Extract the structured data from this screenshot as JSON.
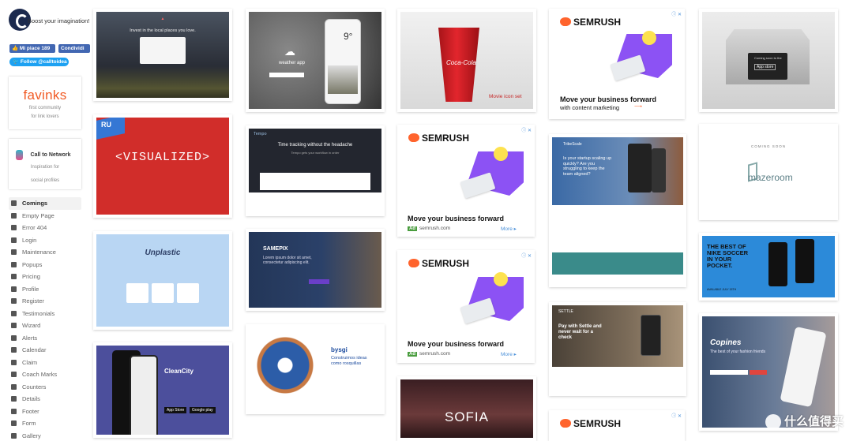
{
  "sidebar": {
    "tagline": "Boost your imagination!",
    "fb_like": "Mi piace 189",
    "fb_share": "Condividi",
    "twitter_follow": "Follow @calltoidea",
    "favinks": {
      "name": "favinks",
      "sub1": "first community",
      "sub2": "for link lovers"
    },
    "ctn": {
      "name": "Call to Network",
      "sub1": "Inspiration for",
      "sub2": "social profiles"
    },
    "menu": [
      {
        "label": "Comings",
        "icon": "flask-icon",
        "active": true
      },
      {
        "label": "Empty Page",
        "icon": "document-icon"
      },
      {
        "label": "Error 404",
        "icon": "error-icon"
      },
      {
        "label": "Login",
        "icon": "login-icon"
      },
      {
        "label": "Maintenance",
        "icon": "gear-icon"
      },
      {
        "label": "Popups",
        "icon": "window-icon"
      },
      {
        "label": "Pricing",
        "icon": "price-icon"
      },
      {
        "label": "Profile",
        "icon": "user-icon"
      },
      {
        "label": "Register",
        "icon": "register-icon"
      },
      {
        "label": "Testimonials",
        "icon": "quote-icon"
      },
      {
        "label": "Wizard",
        "icon": "wizard-icon"
      },
      {
        "label": "Alerts",
        "icon": "alert-icon"
      },
      {
        "label": "Calendar",
        "icon": "calendar-icon"
      },
      {
        "label": "Claim",
        "icon": "megaphone-icon"
      },
      {
        "label": "Coach Marks",
        "icon": "pointer-icon"
      },
      {
        "label": "Counters",
        "icon": "counter-icon"
      },
      {
        "label": "Details",
        "icon": "details-icon"
      },
      {
        "label": "Footer",
        "icon": "footer-icon"
      },
      {
        "label": "Form",
        "icon": "form-icon"
      },
      {
        "label": "Gallery",
        "icon": "gallery-icon"
      }
    ]
  },
  "cards": {
    "invest": {
      "headline": "Invest in the local places you love."
    },
    "weather": {
      "app": "weather app",
      "temp": "9°"
    },
    "cocacola": {
      "caption": "Movie icon set"
    },
    "apple": {
      "caption": "Coming soon to the",
      "store": "App store"
    },
    "visualized": {
      "tag": "RU",
      "title": "<VISUALIZED>"
    },
    "tempo": {
      "brand": "Tempo",
      "headline": "Time tracking without the headache",
      "sub": "Tempo gets your workflow in order"
    },
    "mazeroom": {
      "pre": "COMING SOON",
      "name": "mazeroom"
    },
    "tribescale": {
      "brand": "TribeScale",
      "headline": "Is your startup scaling up quickly? Are you struggling to keep the team aligned?"
    },
    "unplastic": {
      "title": "Unplastic"
    },
    "samepix": {
      "brand": "SAMEPIX",
      "text": "Lorem ipsum dolor sit amet, consectetur adipiscing elit."
    },
    "nike": {
      "headline": "THE BEST OF NIKE SOCCER IN YOUR POCKET.",
      "note": "AVAILABLE JULY 15TH"
    },
    "cleancity": {
      "title": "CleanCity",
      "badge1": "App Store",
      "badge2": "Google play"
    },
    "bysgi": {
      "brand": "bysgi",
      "headline": "Construimos ideas como rosquillas"
    },
    "settle": {
      "brand": "SETTLE",
      "headline": "Pay with Settle and never wait for a check"
    },
    "copines": {
      "title": "Copines",
      "headline": "The best of your fashion friends"
    },
    "sofia": {
      "title": "SOFIA"
    }
  },
  "ads": {
    "brand": "SEMRUSH",
    "close": "ⓘ ✕",
    "headline": "Move your business forward",
    "sub": "with content marketing",
    "domain": "semrush.com",
    "more": "More ▸",
    "ad_tag": "Ad"
  },
  "watermark": "什么值得买"
}
